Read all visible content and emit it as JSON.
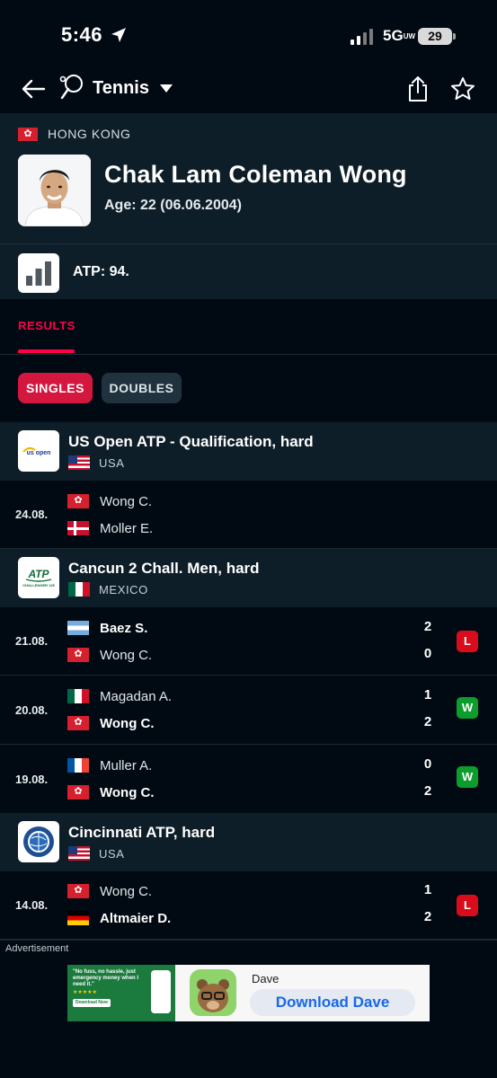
{
  "status_bar": {
    "time": "5:46",
    "network": "5G",
    "network_suffix": "UW",
    "battery": "29"
  },
  "nav": {
    "sport": "Tennis"
  },
  "player": {
    "country": "HONG KONG",
    "name": "Chak Lam Coleman Wong",
    "age": "Age: 22 (06.06.2004)",
    "ranking": "ATP: 94."
  },
  "tabs": {
    "results": "RESULTS"
  },
  "filters": {
    "singles": "SINGLES",
    "doubles": "DOUBLES"
  },
  "tournaments": [
    {
      "name": "US Open ATP - Qualification, hard",
      "country": "USA",
      "logo_text": "us open",
      "matches": [
        {
          "date": "24.08.",
          "p1": "Wong C.",
          "p1_flag": "hk",
          "p2": "Moller E.",
          "p2_flag": "dk",
          "s1": "",
          "s2": "",
          "result": ""
        }
      ]
    },
    {
      "name": "Cancun 2 Chall. Men, hard",
      "country": "MEXICO",
      "logo_text": "ATP",
      "logo_sub": "CHALLENGER 125",
      "matches": [
        {
          "date": "21.08.",
          "p1": "Baez S.",
          "p1_flag": "ar",
          "p2": "Wong C.",
          "p2_flag": "hk",
          "s1": "2",
          "s2": "0",
          "result": "L"
        },
        {
          "date": "20.08.",
          "p1": "Magadan A.",
          "p1_flag": "mx",
          "p2": "Wong C.",
          "p2_flag": "hk",
          "s1": "1",
          "s2": "2",
          "result": "W"
        },
        {
          "date": "19.08.",
          "p1": "Muller A.",
          "p1_flag": "fr",
          "p2": "Wong C.",
          "p2_flag": "hk",
          "s1": "0",
          "s2": "2",
          "result": "W"
        }
      ]
    },
    {
      "name": "Cincinnati ATP, hard",
      "country": "USA",
      "matches": [
        {
          "date": "14.08.",
          "p1": "Wong C.",
          "p1_flag": "hk",
          "p2": "Altmaier D.",
          "p2_flag": "de",
          "s1": "1",
          "s2": "2",
          "result": "L"
        }
      ]
    }
  ],
  "ad": {
    "label": "Advertisement",
    "copy": "\"No fuss, no hassle, just emergency money when I need it.\"",
    "stars": "★★★★★",
    "small_cta": "Download Now",
    "brand": "Dave",
    "cta": "Download Dave"
  },
  "colors": {
    "accent": "#ff0046",
    "win": "#0c9d2c",
    "loss": "#d80c1b",
    "panel": "#0d1e28",
    "background": "#010a12"
  }
}
